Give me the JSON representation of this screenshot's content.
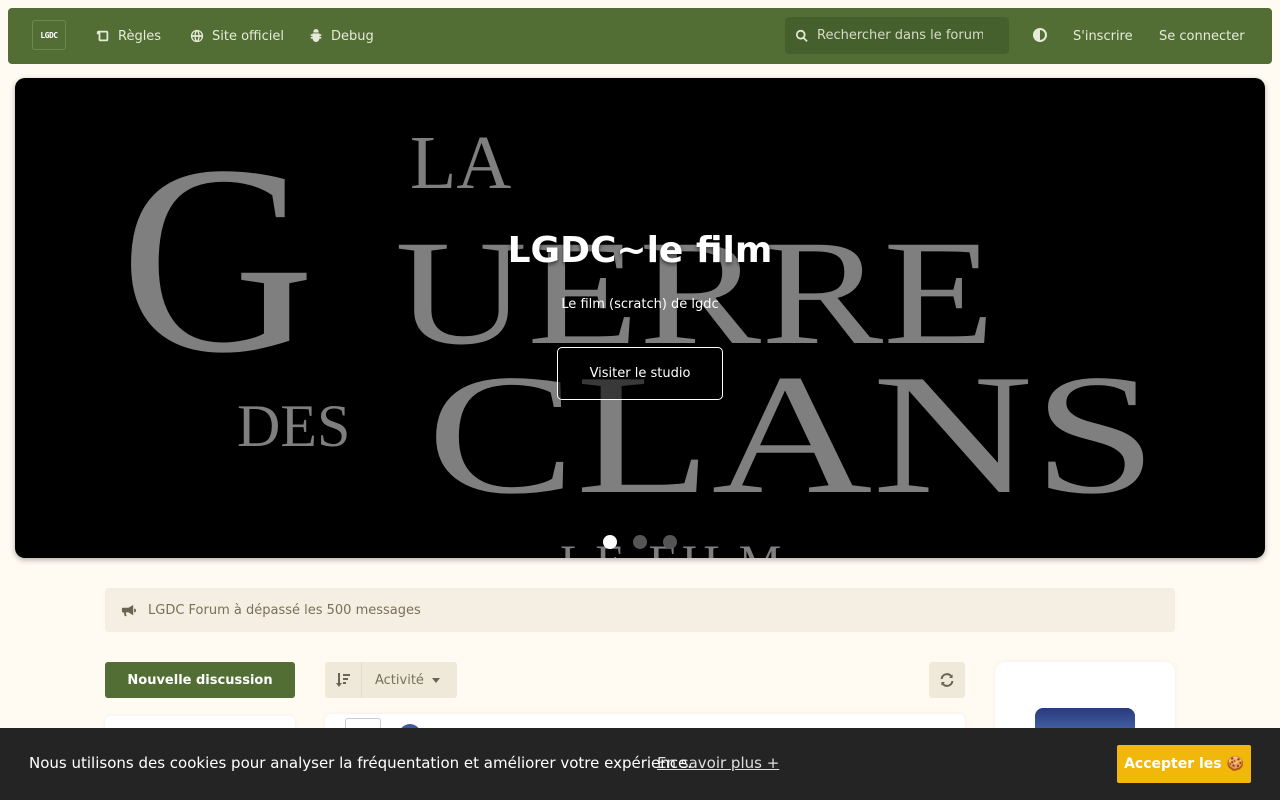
{
  "navbar": {
    "logo_text": "LGDC",
    "links": [
      {
        "label": "Règles",
        "icon": "scroll-icon"
      },
      {
        "label": "Site officiel",
        "icon": "globe-icon"
      },
      {
        "label": "Debug",
        "icon": "bug-icon"
      }
    ],
    "search_placeholder": "Rechercher dans le forum",
    "signup_label": "S'inscrire",
    "login_label": "Se connecter"
  },
  "hero": {
    "background_text": {
      "line1_big": "G",
      "line1_small": "LA",
      "line2": "UERRE",
      "line3_small": "DES",
      "line3": "CLANS",
      "bottom": "LE FILM"
    },
    "title": "LGDC~le film",
    "subtitle": "Le film (scratch) de lgdc",
    "button_label": "Visiter le studio",
    "slide_count": 3,
    "active_slide": 0
  },
  "announcement": {
    "text": "LGDC Forum à dépassé les 500 messages",
    "icon": "megaphone-icon"
  },
  "controls": {
    "new_discussion_label": "Nouvelle discussion",
    "sort_label": "Activité"
  },
  "cookie": {
    "message": "Nous utilisons des cookies pour analyser la fréquentation et améliorer votre expérience.",
    "learn_more": "En savoir plus +",
    "accept_label": "Accepter les 🍪"
  },
  "colors": {
    "navbar": "#526e35",
    "background": "#fffaf2",
    "accept": "#f1b70b"
  }
}
